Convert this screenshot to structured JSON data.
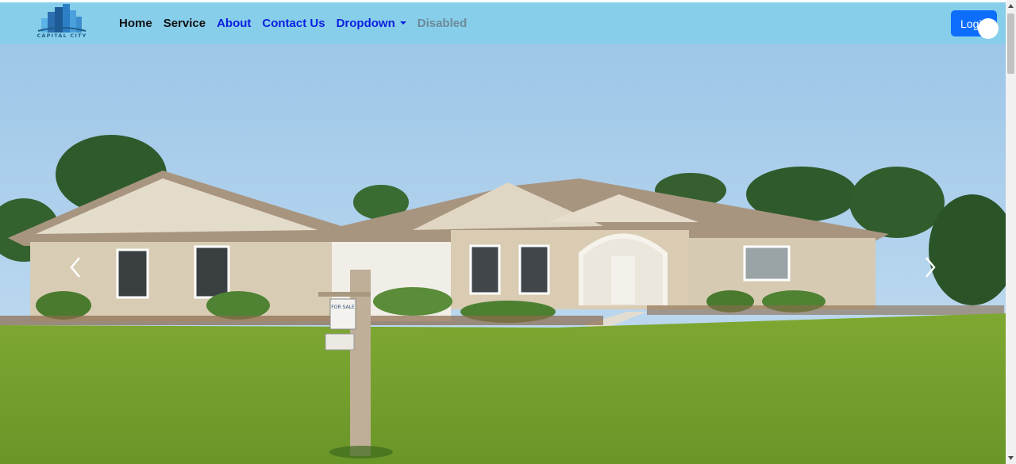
{
  "brand": {
    "name": "CAPITAL CITY"
  },
  "nav": {
    "items": [
      {
        "label": "Home"
      },
      {
        "label": "Service"
      },
      {
        "label": "About"
      },
      {
        "label": "Contact Us"
      },
      {
        "label": "Dropdown"
      },
      {
        "label": "Disabled"
      }
    ]
  },
  "login": {
    "label": "Login"
  },
  "hero": {
    "sign_text": "FOR SALE"
  },
  "colors": {
    "navbar": "#87ceeb",
    "nav_link_dark": "#111111",
    "nav_link_blue": "#0a1fe0",
    "nav_link_disabled": "#6c8a99",
    "login_button": "#0d6efd"
  },
  "icons": {
    "prev": "chevron-left-icon",
    "next": "chevron-right-icon",
    "dropdown": "caret-down-icon"
  }
}
